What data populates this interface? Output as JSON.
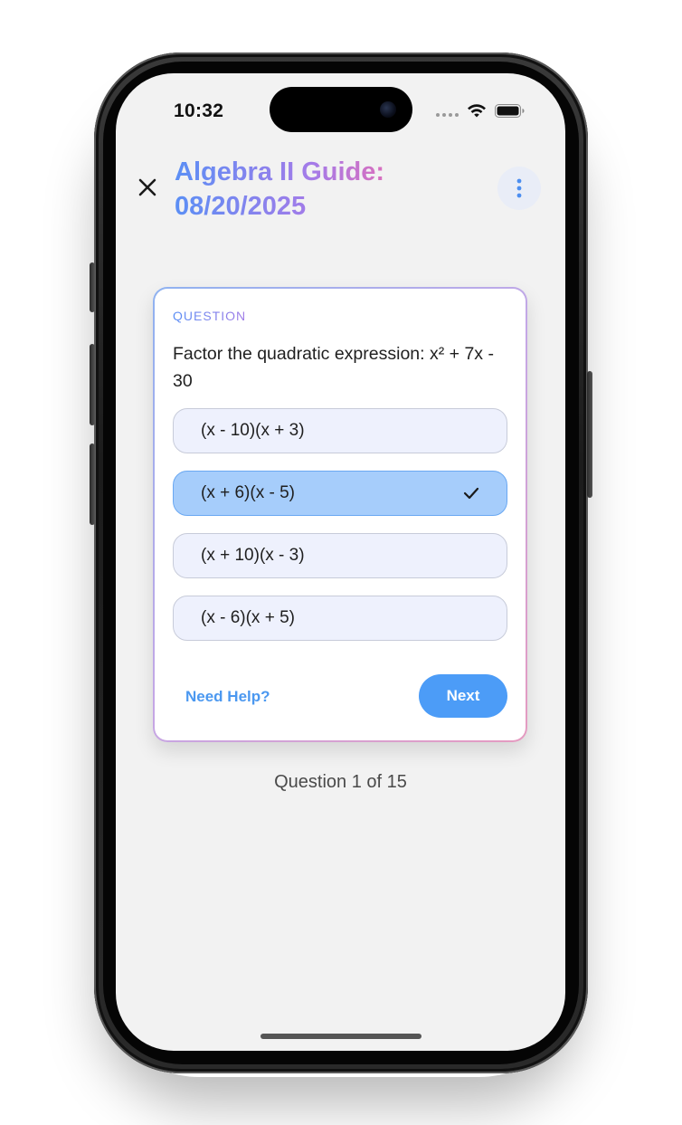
{
  "status_bar": {
    "time": "10:32"
  },
  "header": {
    "title": "Algebra II Guide: 08/20/2025",
    "close_icon": "close-icon",
    "more_icon": "more-vertical-icon",
    "title_gradient": [
      "#5b8ff5",
      "#a57be8",
      "#f36aa9"
    ]
  },
  "card": {
    "kicker": "QUESTION",
    "question": "Factor the quadratic expression: x² + 7x - 30",
    "options": [
      {
        "label": "(x - 10)(x + 3)",
        "selected": false
      },
      {
        "label": "(x + 6)(x - 5)",
        "selected": true
      },
      {
        "label": "(x + 10)(x - 3)",
        "selected": false
      },
      {
        "label": "(x - 6)(x + 5)",
        "selected": false
      }
    ],
    "help_label": "Need Help?",
    "next_label": "Next"
  },
  "progress": {
    "text": "Question 1 of 15",
    "current": 1,
    "total": 15
  },
  "colors": {
    "accent": "#4c9cf7",
    "selected_option": "#a6cdfb",
    "option_bg": "#eef1fd",
    "screen_bg": "#f2f2f2"
  }
}
